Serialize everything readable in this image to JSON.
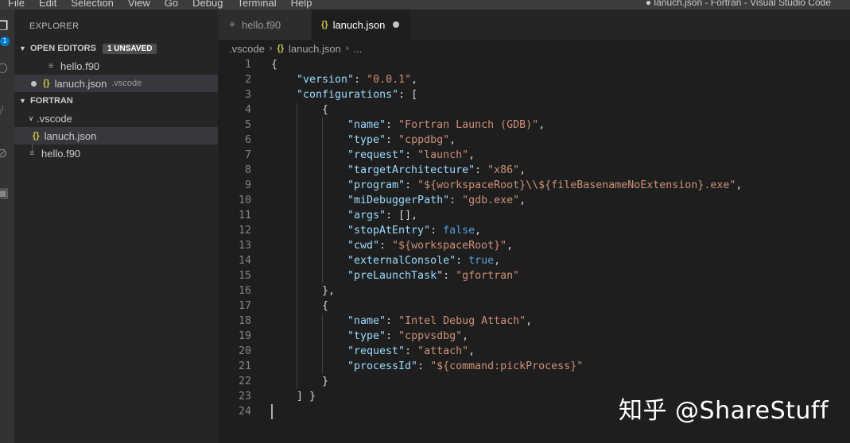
{
  "menu": [
    "File",
    "Edit",
    "Selection",
    "View",
    "Go",
    "Debug",
    "Terminal",
    "Help"
  ],
  "window_title": "● lanuch.json - Fortran - Visual Studio Code",
  "activity": {
    "explorer_badge": "1"
  },
  "sidebar": {
    "title": "EXPLORER",
    "open_editors": {
      "label": "OPEN EDITORS",
      "badge": "1 UNSAVED",
      "items": [
        {
          "name": "hello.f90",
          "desc": ""
        },
        {
          "name": "lanuch.json",
          "desc": ".vscode"
        }
      ]
    },
    "folder": {
      "label": "FORTRAN",
      "subfolder": ".vscode",
      "items": [
        "lanuch.json",
        "hello.f90"
      ]
    }
  },
  "tabs": [
    {
      "label": "hello.f90"
    },
    {
      "label": "lanuch.json"
    }
  ],
  "breadcrumb": {
    "folder": ".vscode",
    "file": "lanuch.json",
    "more": "..."
  },
  "code": {
    "line_numbers": [
      "1",
      "2",
      "3",
      "4",
      "5",
      "6",
      "7",
      "8",
      "9",
      "10",
      "11",
      "12",
      "13",
      "14",
      "15",
      "16",
      "17",
      "18",
      "19",
      "20",
      "21",
      "22",
      "23",
      "24"
    ],
    "lines": [
      [
        [
          "p",
          "{"
        ]
      ],
      [
        [
          "k",
          "\"version\""
        ],
        [
          "p",
          ": "
        ],
        [
          "s",
          "\"0.0.1\""
        ],
        [
          "p",
          ","
        ]
      ],
      [
        [
          "k",
          "\"configurations\""
        ],
        [
          "p",
          ": ["
        ]
      ],
      [
        [
          "p",
          "{"
        ]
      ],
      [
        [
          "k",
          "\"name\""
        ],
        [
          "p",
          ": "
        ],
        [
          "s",
          "\"Fortran Launch (GDB)\""
        ],
        [
          "p",
          ","
        ]
      ],
      [
        [
          "k",
          "\"type\""
        ],
        [
          "p",
          ": "
        ],
        [
          "s",
          "\"cppdbg\""
        ],
        [
          "p",
          ","
        ]
      ],
      [
        [
          "k",
          "\"request\""
        ],
        [
          "p",
          ": "
        ],
        [
          "s",
          "\"launch\""
        ],
        [
          "p",
          ","
        ]
      ],
      [
        [
          "k",
          "\"targetArchitecture\""
        ],
        [
          "p",
          ": "
        ],
        [
          "s",
          "\"x86\""
        ],
        [
          "p",
          ","
        ]
      ],
      [
        [
          "k",
          "\"program\""
        ],
        [
          "p",
          ": "
        ],
        [
          "s",
          "\"${workspaceRoot}\\\\${fileBasenameNoExtension}.exe\""
        ],
        [
          "p",
          ","
        ]
      ],
      [
        [
          "k",
          "\"miDebuggerPath\""
        ],
        [
          "p",
          ": "
        ],
        [
          "s",
          "\"gdb.exe\""
        ],
        [
          "p",
          ","
        ]
      ],
      [
        [
          "k",
          "\"args\""
        ],
        [
          "p",
          ": [],"
        ]
      ],
      [
        [
          "k",
          "\"stopAtEntry\""
        ],
        [
          "p",
          ": "
        ],
        [
          "b",
          "false"
        ],
        [
          "p",
          ","
        ]
      ],
      [
        [
          "k",
          "\"cwd\""
        ],
        [
          "p",
          ": "
        ],
        [
          "s",
          "\"${workspaceRoot}\""
        ],
        [
          "p",
          ","
        ]
      ],
      [
        [
          "k",
          "\"externalConsole\""
        ],
        [
          "p",
          ": "
        ],
        [
          "b",
          "true"
        ],
        [
          "p",
          ","
        ]
      ],
      [
        [
          "k",
          "\"preLaunchTask\""
        ],
        [
          "p",
          ": "
        ],
        [
          "s",
          "\"gfortran\""
        ]
      ],
      [
        [
          "p",
          "},"
        ]
      ],
      [
        [
          "p",
          "{"
        ]
      ],
      [
        [
          "k",
          "\"name\""
        ],
        [
          "p",
          ": "
        ],
        [
          "s",
          "\"Intel Debug Attach\""
        ],
        [
          "p",
          ","
        ]
      ],
      [
        [
          "k",
          "\"type\""
        ],
        [
          "p",
          ": "
        ],
        [
          "s",
          "\"cppvsdbg\""
        ],
        [
          "p",
          ","
        ]
      ],
      [
        [
          "k",
          "\"request\""
        ],
        [
          "p",
          ": "
        ],
        [
          "s",
          "\"attach\""
        ],
        [
          "p",
          ","
        ]
      ],
      [
        [
          "k",
          "\"processId\""
        ],
        [
          "p",
          ": "
        ],
        [
          "s",
          "\"${command:pickProcess}\""
        ]
      ],
      [
        [
          "p",
          "}"
        ]
      ],
      [
        [
          "p",
          "] }"
        ]
      ],
      []
    ],
    "indents": [
      0,
      1,
      1,
      2,
      3,
      3,
      3,
      3,
      3,
      3,
      3,
      3,
      3,
      3,
      3,
      2,
      2,
      3,
      3,
      3,
      3,
      2,
      1,
      0
    ]
  },
  "watermark": "知乎 @ShareStuff"
}
